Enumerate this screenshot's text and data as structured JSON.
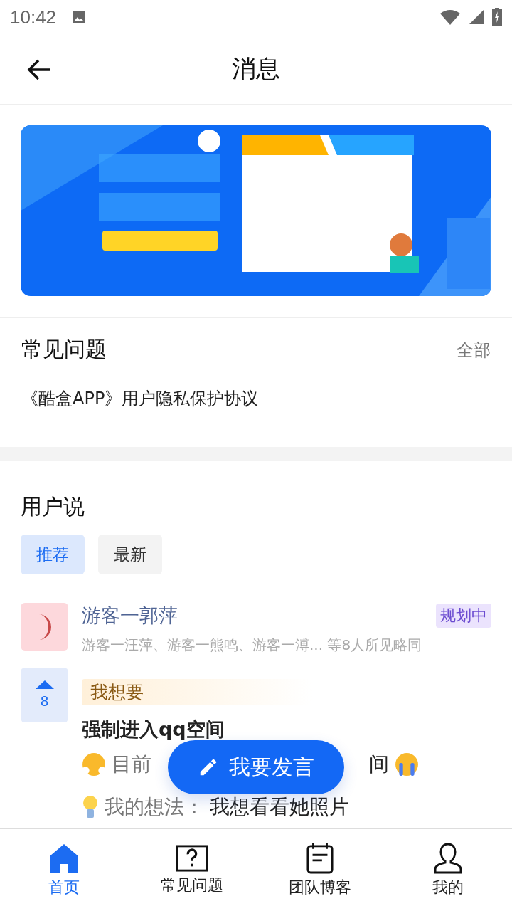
{
  "status_bar": {
    "time": "10:42"
  },
  "header": {
    "title": "消息"
  },
  "faq": {
    "title": "常见问题",
    "more": "全部",
    "items": [
      "《酷盒APP》用户隐私保护协议"
    ]
  },
  "user_say": {
    "title": "用户说",
    "tabs": [
      {
        "label": "推荐",
        "selected": true
      },
      {
        "label": "最新",
        "selected": false
      }
    ],
    "posts": [
      {
        "author": "游客一郭萍",
        "status": "规划中",
        "agree": "游客一汪萍、游客一熊鸣、游客一溥... 等8人所见略同",
        "votes": "8",
        "tag": "我想要",
        "title": "强制进入qq空间",
        "line_1_start": "目前",
        "line_1_end": "间",
        "line_2_label": "我的想法：",
        "line_2_text": "我想看看她照片"
      }
    ]
  },
  "fab": {
    "label": "我要发言"
  },
  "tabbar": [
    {
      "label": "首页",
      "kind": "home",
      "selected": true
    },
    {
      "label": "常见问题",
      "kind": "faq",
      "selected": false
    },
    {
      "label": "团队博客",
      "kind": "blog",
      "selected": false
    },
    {
      "label": "我的",
      "kind": "me",
      "selected": false
    }
  ]
}
